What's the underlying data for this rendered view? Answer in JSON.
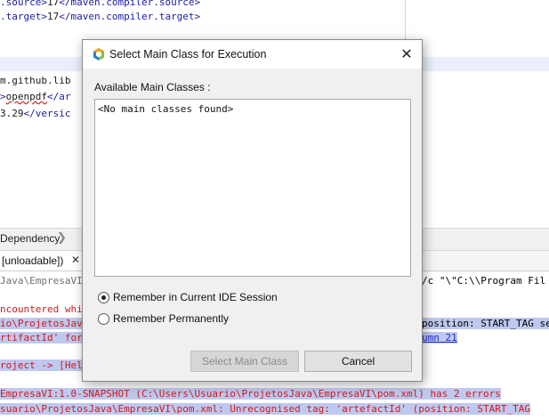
{
  "editor": {
    "lines": [
      {
        "tag_open": ".source>",
        "text": "17",
        "tag_close": "</maven.compiler.source>"
      },
      {
        "tag_open": ".target>",
        "text": "17",
        "tag_close": "</maven.compiler.target>"
      },
      {
        "text": "m.github.lib"
      },
      {
        "tag_open": ">",
        "text": "openpdf",
        "tag_close": "</ar"
      },
      {
        "text": "3.29",
        "tag_close": "</versic"
      }
    ]
  },
  "breadcrumb": {
    "label": "Dependency"
  },
  "output_tab": {
    "label": "[unloadable])",
    "close": "✕"
  },
  "output": {
    "line1_left": "Java\\EmpresaVI",
    "line1_right": "/c \"\\\"C:\\\\Program Fil",
    "line2_left": "ncountered whi",
    "line3_left": "io\\ProjetosJava",
    "line3_right": "position: START_TAG se",
    "line4_left": "rtifactId' for c",
    "line4_right": "umn 21",
    "line5": "roject -> [Hel",
    "line6": "EmpresaVI:1.0-SNAPSHOT (C:\\Users\\Usuario\\ProjetosJava\\EmpresaVI\\pom.xml) has 2 errors",
    "line7": "suario\\ProjetosJava\\EmpresaVI\\pom.xml: Unrecognised tag: 'artefactId' (position: START_TAG"
  },
  "dialog": {
    "title": "Select Main Class for Execution",
    "close_icon": "close-icon",
    "available_label": "Available Main Classes :",
    "empty_text": "<No main classes found>",
    "radio_session": "Remember in Current IDE Session",
    "radio_permanent": "Remember Permanently",
    "radio_session_selected": true,
    "select_button": "Select Main Class",
    "cancel_button": "Cancel"
  },
  "colors": {
    "error": "#d11a1a",
    "selection": "#bfc8ee",
    "xml_tag": "#1b1ba8"
  }
}
